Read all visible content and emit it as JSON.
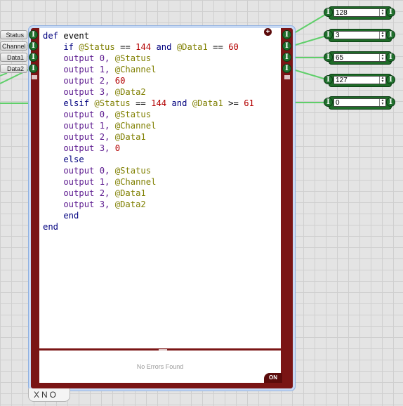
{
  "inputs": [
    {
      "label": "Status"
    },
    {
      "label": "Channel"
    },
    {
      "label": "Data1"
    },
    {
      "label": "Data2"
    }
  ],
  "port_glyph": "I",
  "code": {
    "lines": [
      [
        {
          "t": "def ",
          "c": "kw"
        },
        {
          "t": "event",
          "c": "plain"
        }
      ],
      [
        {
          "t": "    if ",
          "c": "kw"
        },
        {
          "t": "@Status",
          "c": "var"
        },
        {
          "t": " == ",
          "c": "plain"
        },
        {
          "t": "144",
          "c": "num"
        },
        {
          "t": " and ",
          "c": "kw"
        },
        {
          "t": "@Data1",
          "c": "var"
        },
        {
          "t": " == ",
          "c": "plain"
        },
        {
          "t": "60",
          "c": "num"
        }
      ],
      [
        {
          "t": "    output ",
          "c": "meth"
        },
        {
          "t": "0, ",
          "c": "meth"
        },
        {
          "t": "@Status",
          "c": "var"
        }
      ],
      [
        {
          "t": "    output ",
          "c": "meth"
        },
        {
          "t": "1, ",
          "c": "meth"
        },
        {
          "t": "@Channel",
          "c": "var"
        }
      ],
      [
        {
          "t": "    output ",
          "c": "meth"
        },
        {
          "t": "2, ",
          "c": "meth"
        },
        {
          "t": "60",
          "c": "num"
        }
      ],
      [
        {
          "t": "    output ",
          "c": "meth"
        },
        {
          "t": "3, ",
          "c": "meth"
        },
        {
          "t": "@Data2",
          "c": "var"
        }
      ],
      [
        {
          "t": "    elsif ",
          "c": "kw"
        },
        {
          "t": "@Status",
          "c": "var"
        },
        {
          "t": " == ",
          "c": "plain"
        },
        {
          "t": "144",
          "c": "num"
        },
        {
          "t": " and ",
          "c": "kw"
        },
        {
          "t": "@Data1",
          "c": "var"
        },
        {
          "t": " >= ",
          "c": "plain"
        },
        {
          "t": "61",
          "c": "num"
        }
      ],
      [
        {
          "t": "    output ",
          "c": "meth"
        },
        {
          "t": "0, ",
          "c": "meth"
        },
        {
          "t": "@Status",
          "c": "var"
        }
      ],
      [
        {
          "t": "    output ",
          "c": "meth"
        },
        {
          "t": "1, ",
          "c": "meth"
        },
        {
          "t": "@Channel",
          "c": "var"
        }
      ],
      [
        {
          "t": "    output ",
          "c": "meth"
        },
        {
          "t": "2, ",
          "c": "meth"
        },
        {
          "t": "@Data1",
          "c": "var"
        }
      ],
      [
        {
          "t": "    output ",
          "c": "meth"
        },
        {
          "t": "3, ",
          "c": "meth"
        },
        {
          "t": "0",
          "c": "num"
        }
      ],
      [
        {
          "t": "    else",
          "c": "kw"
        }
      ],
      [
        {
          "t": "    output ",
          "c": "meth"
        },
        {
          "t": "0, ",
          "c": "meth"
        },
        {
          "t": "@Status",
          "c": "var"
        }
      ],
      [
        {
          "t": "    output ",
          "c": "meth"
        },
        {
          "t": "1, ",
          "c": "meth"
        },
        {
          "t": "@Channel",
          "c": "var"
        }
      ],
      [
        {
          "t": "    output ",
          "c": "meth"
        },
        {
          "t": "2, ",
          "c": "meth"
        },
        {
          "t": "@Data1",
          "c": "var"
        }
      ],
      [
        {
          "t": "    output ",
          "c": "meth"
        },
        {
          "t": "3, ",
          "c": "meth"
        },
        {
          "t": "@Data2",
          "c": "var"
        }
      ],
      [
        {
          "t": "    end",
          "c": "kw"
        }
      ],
      [
        {
          "t": "end",
          "c": "kw"
        }
      ]
    ]
  },
  "status_text": "No Errors Found",
  "on_button": "ON",
  "add_button_glyph": "+",
  "tabs_text": "XNO",
  "outputs": [
    {
      "value": "128"
    },
    {
      "value": "3"
    },
    {
      "value": "65"
    },
    {
      "value": "127"
    },
    {
      "value": "0"
    }
  ],
  "colors": {
    "frame": "#7a1515",
    "port": "#1f6f2c",
    "wire": "#5fcf6a",
    "keyword": "#00007f",
    "variable": "#7f7f00",
    "number": "#b30000",
    "method": "#5c1a8f"
  }
}
